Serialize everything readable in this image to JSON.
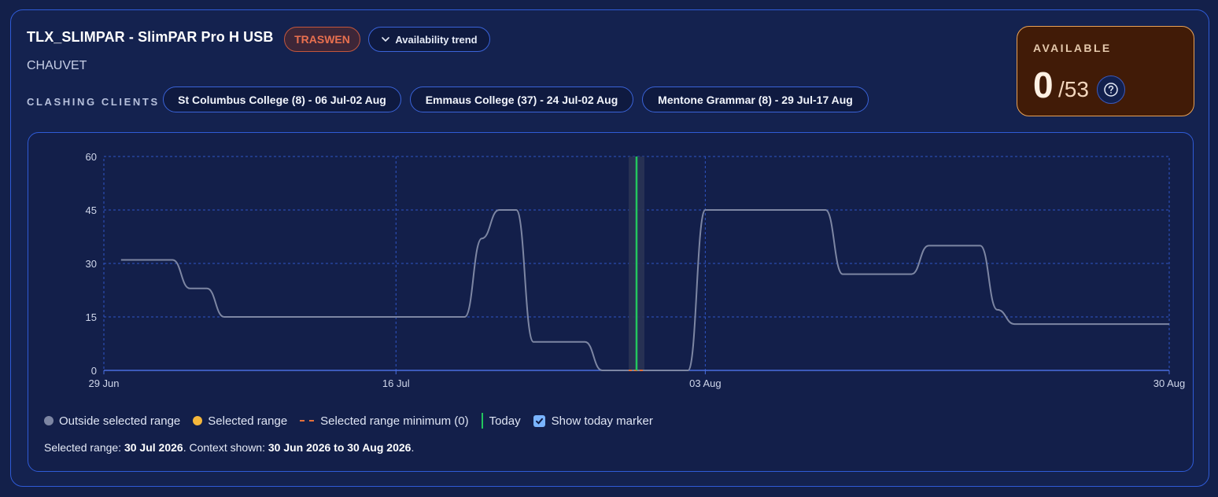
{
  "header": {
    "title": "TLX_SLIMPAR - SlimPAR Pro H USB",
    "status_badge": "TRASWEN",
    "trend_button": "Availability trend",
    "brand": "CHAUVET",
    "clashing_label": "CLASHING CLIENTS",
    "clashing_clients": [
      "St Columbus College (8) - 06 Jul-02 Aug",
      "Emmaus College (37) - 24 Jul-02 Aug",
      "Mentone Grammar (8) - 29 Jul-17 Aug"
    ]
  },
  "availability": {
    "label": "AVAILABLE",
    "available": "0",
    "total": "/53"
  },
  "legend": {
    "outside": "Outside selected range",
    "selected": "Selected range",
    "minimum": "Selected range minimum (0)",
    "today": "Today",
    "show_today": "Show today marker"
  },
  "range_note": {
    "prefix": "Selected range: ",
    "selected": "30 Jul 2026",
    "middle": ". Context shown: ",
    "context": "30 Jun 2026 to 30 Aug 2026",
    "suffix": "."
  },
  "colors": {
    "line": "#7d86a3",
    "selected": "#f5b73b",
    "minimum": "#e5703c",
    "today": "#22c55e",
    "grid": "#2f55c7"
  },
  "chart_data": {
    "type": "line",
    "x_ticks": [
      "29 Jun",
      "16 Jul",
      "03 Aug",
      "30 Aug"
    ],
    "x_tick_dates": [
      "2026-06-29",
      "2026-07-16",
      "2026-08-03",
      "2026-08-30"
    ],
    "y_ticks": [
      0,
      15,
      30,
      45,
      60
    ],
    "ylim": [
      0,
      60
    ],
    "selected_range": [
      "2026-07-30",
      "2026-07-30"
    ],
    "today": "2026-07-30",
    "series": [
      {
        "values": [
          [
            "2026-06-30",
            31
          ],
          [
            "2026-07-03",
            31
          ],
          [
            "2026-07-04",
            23
          ],
          [
            "2026-07-05",
            23
          ],
          [
            "2026-07-06",
            15
          ],
          [
            "2026-07-20",
            15
          ],
          [
            "2026-07-21",
            37
          ],
          [
            "2026-07-22",
            45
          ],
          [
            "2026-07-23",
            45
          ],
          [
            "2026-07-24",
            8
          ],
          [
            "2026-07-27",
            8
          ],
          [
            "2026-07-28",
            0
          ],
          [
            "2026-08-02",
            0
          ],
          [
            "2026-08-03",
            45
          ],
          [
            "2026-08-10",
            45
          ],
          [
            "2026-08-11",
            27
          ],
          [
            "2026-08-15",
            27
          ],
          [
            "2026-08-16",
            35
          ],
          [
            "2026-08-19",
            35
          ],
          [
            "2026-08-20",
            17
          ],
          [
            "2026-08-21",
            13
          ],
          [
            "2026-08-30",
            13
          ]
        ]
      }
    ]
  }
}
